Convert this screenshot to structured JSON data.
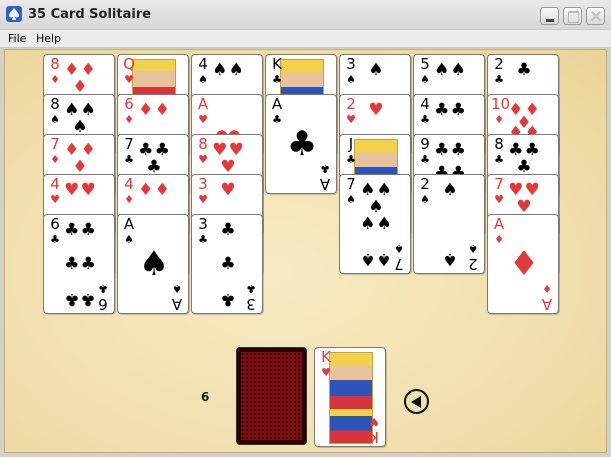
{
  "window": {
    "title": "35 Card Solitaire",
    "icon": "spade-icon"
  },
  "menu": [
    "File",
    "Help"
  ],
  "columns": [
    {
      "cards": [
        {
          "rank": "8",
          "suit": "♦",
          "color": "red"
        },
        {
          "rank": "8",
          "suit": "♠",
          "color": "black"
        },
        {
          "rank": "7",
          "suit": "♦",
          "color": "red"
        },
        {
          "rank": "4",
          "suit": "♥",
          "color": "red"
        },
        {
          "rank": "6",
          "suit": "♣",
          "color": "black"
        }
      ]
    },
    {
      "cards": [
        {
          "rank": "Q",
          "suit": "♥",
          "color": "red"
        },
        {
          "rank": "6",
          "suit": "♦",
          "color": "red"
        },
        {
          "rank": "7",
          "suit": "♣",
          "color": "black"
        },
        {
          "rank": "4",
          "suit": "♦",
          "color": "red"
        },
        {
          "rank": "A",
          "suit": "♠",
          "color": "black"
        }
      ]
    },
    {
      "cards": [
        {
          "rank": "4",
          "suit": "♠",
          "color": "black"
        },
        {
          "rank": "A",
          "suit": "♥",
          "color": "red"
        },
        {
          "rank": "8",
          "suit": "♥",
          "color": "red"
        },
        {
          "rank": "3",
          "suit": "♥",
          "color": "red"
        },
        {
          "rank": "3",
          "suit": "♣",
          "color": "black"
        }
      ]
    },
    {
      "cards": [
        {
          "rank": "K",
          "suit": "♣",
          "color": "black"
        },
        {
          "rank": "A",
          "suit": "♣",
          "color": "black"
        }
      ]
    },
    {
      "cards": [
        {
          "rank": "3",
          "suit": "♠",
          "color": "black"
        },
        {
          "rank": "2",
          "suit": "♥",
          "color": "red"
        },
        {
          "rank": "J",
          "suit": "♣",
          "color": "black"
        },
        {
          "rank": "7",
          "suit": "♠",
          "color": "black"
        }
      ]
    },
    {
      "cards": [
        {
          "rank": "5",
          "suit": "♠",
          "color": "black"
        },
        {
          "rank": "4",
          "suit": "♣",
          "color": "black"
        },
        {
          "rank": "9",
          "suit": "♣",
          "color": "black"
        },
        {
          "rank": "2",
          "suit": "♠",
          "color": "black"
        }
      ]
    },
    {
      "cards": [
        {
          "rank": "2",
          "suit": "♣",
          "color": "black"
        },
        {
          "rank": "10",
          "suit": "♦",
          "color": "red"
        },
        {
          "rank": "8",
          "suit": "♣",
          "color": "black"
        },
        {
          "rank": "7",
          "suit": "♥",
          "color": "red"
        },
        {
          "rank": "A",
          "suit": "♦",
          "color": "red"
        }
      ]
    }
  ],
  "stock": {
    "count": "6"
  },
  "waste": {
    "rank": "K",
    "suit": "♥",
    "color": "red"
  },
  "undo": {
    "icon": "left-arrow-icon"
  }
}
